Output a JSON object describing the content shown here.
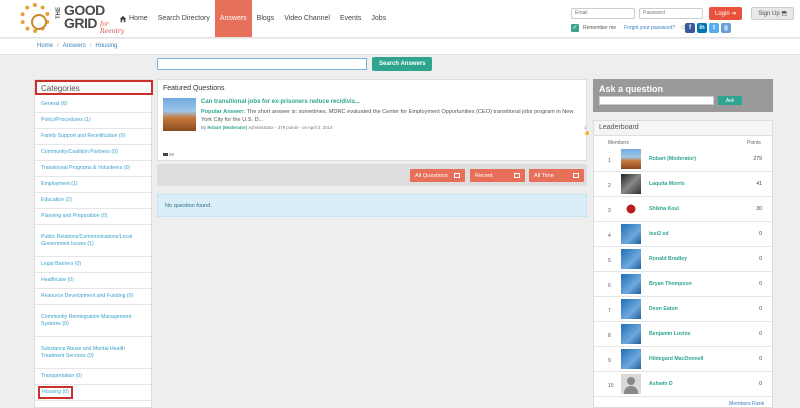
{
  "logo": {
    "the": "THE",
    "good": "GOOD",
    "grid": "GRID",
    "tagline": "for Reentry"
  },
  "nav": {
    "home": "Home",
    "search_directory": "Search Directory",
    "answers": "Answers",
    "blogs": "Blogs",
    "video_channel": "Video Channel",
    "events": "Events",
    "jobs": "Jobs"
  },
  "login": {
    "email_placeholder": "Email",
    "password_placeholder": "Password",
    "login_label": "Login ➔",
    "signup_label": "Sign Up ⬒",
    "remember_me": "Remember me",
    "forgot": "Forgot your password?",
    "or": "Or"
  },
  "social": [
    {
      "label": "f",
      "color": "#3b5998"
    },
    {
      "label": "in",
      "color": "#0077b5"
    },
    {
      "label": "t",
      "color": "#55acee"
    },
    {
      "label": "g",
      "color": "#6aa0d8"
    }
  ],
  "breadcrumb": [
    "Home",
    "Answers",
    "Housing"
  ],
  "search": {
    "button": "Search Answers"
  },
  "categories": {
    "title": "Categories",
    "items": [
      "General (6)",
      "Policy/Procedures (1)",
      "Family Support and Reunification (0)",
      "Community/Coalition Partners (0)",
      "Transitional Programs & Volunteers (0)",
      "Employment (1)",
      "Education (2)",
      "Planning and Preparation (0)",
      "Public Relations/Communications/Local Government Issues (1)",
      "Legal Barriers (0)",
      "Healthcare (0)",
      "Resource Development and Funding (0)",
      "Community Reintegration Management Systems (0)",
      "Substance Abuse and Mental Health Treatment Services (0)",
      "Transportation (0)",
      "Housing (0)"
    ]
  },
  "featured": {
    "heading": "Featured Questions",
    "title": "Can transitional jobs for ex-prisoners reduce recidivis...",
    "answer_label": "Popular Answer:",
    "answer_text": " The short answer is: sometimes. MDRC evaluated the Center for Employment Opportunities (CEO) transitional jobs program in New York City for the U.S. D...",
    "by": "By",
    "author": "Robart (Moderator)",
    "meta": " Administrator - 279 points - on April 2, 2014",
    "count": "1👍"
  },
  "filters": [
    "All Questions",
    "Recent",
    "All Time"
  ],
  "no_questions": "No question found.",
  "ask": {
    "title": "Ask a question",
    "button": "Ask"
  },
  "leaderboard": {
    "title": "Leaderboard",
    "col_members": "Members",
    "col_points": "Points",
    "rows": [
      {
        "rank": "1",
        "name": "Robart (Moderator)",
        "points": "279"
      },
      {
        "rank": "2",
        "name": "Laquita Morris",
        "points": "41"
      },
      {
        "rank": "3",
        "name": "Shikha Koul",
        "points": "30"
      },
      {
        "rank": "4",
        "name": "test2 ed",
        "points": "0"
      },
      {
        "rank": "5",
        "name": "Ronald Bradley",
        "points": "0"
      },
      {
        "rank": "6",
        "name": "Bryan Thompson",
        "points": "0"
      },
      {
        "rank": "7",
        "name": "Deon Eaton",
        "points": "0"
      },
      {
        "rank": "8",
        "name": "Benjamin Lovins",
        "points": "0"
      },
      {
        "rank": "9",
        "name": "Hildegard MacDonnell",
        "points": "0"
      },
      {
        "rank": "10",
        "name": "Ashwin D",
        "points": "0"
      }
    ],
    "more": "Members Rank"
  }
}
